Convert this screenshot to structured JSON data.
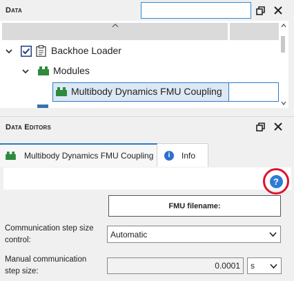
{
  "data_panel": {
    "title": "Data",
    "search": {
      "value": "",
      "placeholder": ""
    },
    "tree": [
      {
        "label": "Backhoe Loader",
        "checked": true,
        "expanded": true,
        "icon": "clipboard-icon"
      },
      {
        "label": "Modules",
        "expanded": true,
        "icon": "modules-icon"
      },
      {
        "label": "Multibody Dynamics FMU Coupling",
        "selected": true,
        "icon": "modules-icon"
      }
    ]
  },
  "editors_panel": {
    "title": "Data Editors",
    "tabs": [
      {
        "label": "Multibody Dynamics FMU Coupling",
        "icon": "modules-icon",
        "active": true
      },
      {
        "label": "Info",
        "icon": "info-icon",
        "active": false
      }
    ],
    "help_icon": "question-icon",
    "fmu_button_label": "FMU filename:",
    "comm_step_control": {
      "label_line1": "Communication step size",
      "label_line2": "control:",
      "value": "Automatic"
    },
    "manual_step": {
      "label_line1": "Manual communication",
      "label_line2": "step size:",
      "value": "0.0001",
      "unit": "s"
    }
  },
  "colors": {
    "accent": "#2b7ac9",
    "module_green": "#2f8a3e",
    "help_blue": "#2e7bd6",
    "highlight_red": "#e0102a"
  }
}
